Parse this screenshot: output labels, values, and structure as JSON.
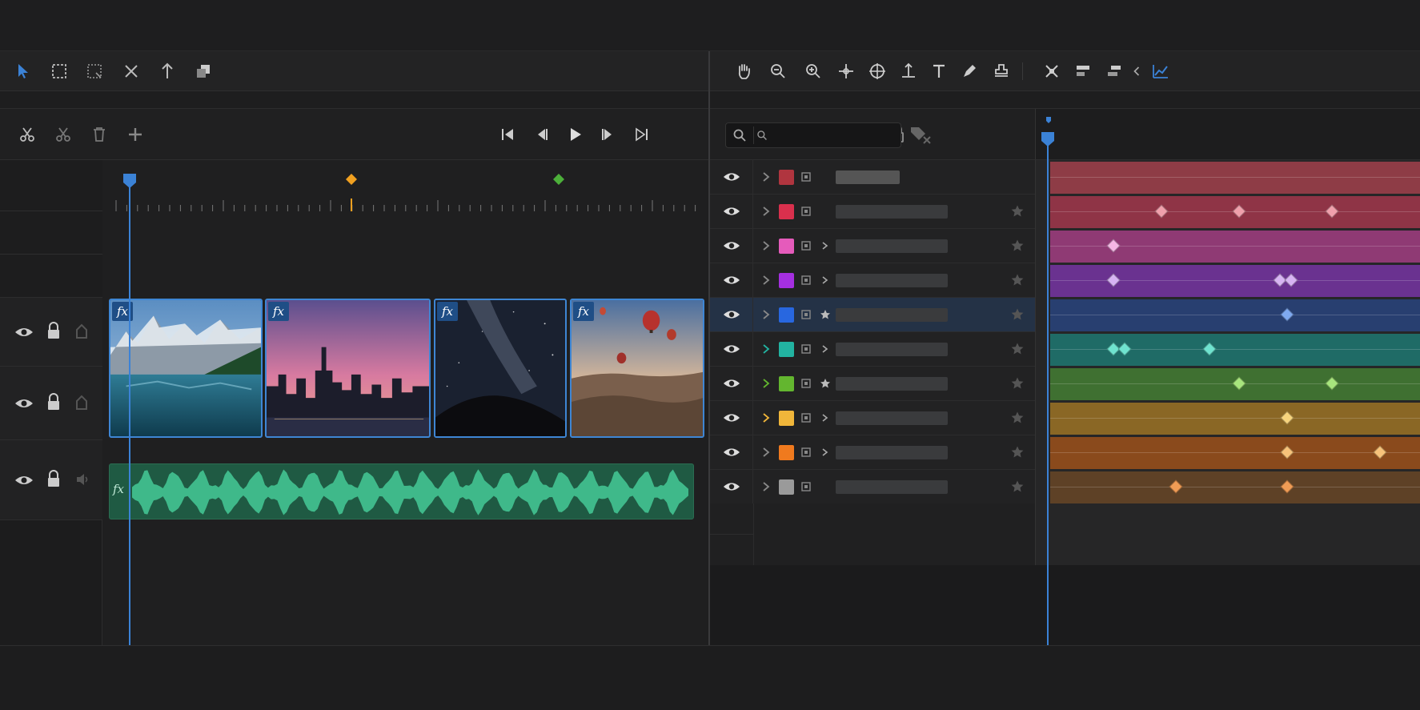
{
  "colors": {
    "accent": "#3b82d6",
    "marker_orange": "#f0a020",
    "marker_green": "#4caf3a",
    "audio_wave": "#3fb98a"
  },
  "left_toolbar": {
    "tools": [
      "select-arrow-icon",
      "marquee-select-icon",
      "lasso-select-icon",
      "ripple-edit-icon",
      "slip-tool-icon",
      "stack-icon"
    ]
  },
  "edit_tools": [
    "razor-icon",
    "cut-icon",
    "trash-icon",
    "insert-icon"
  ],
  "transport": [
    "skip-to-start-icon",
    "step-back-icon",
    "play-icon",
    "step-forward-icon",
    "skip-to-end-icon"
  ],
  "video_clips": [
    {
      "fx": "fx",
      "scene": "mountain-lake"
    },
    {
      "fx": "fx",
      "scene": "city-sunset"
    },
    {
      "fx": "fx",
      "scene": "milky-way"
    },
    {
      "fx": "fx",
      "scene": "hot-air-balloons"
    }
  ],
  "audio_clip": {
    "fx": "fx"
  },
  "right_toolbar": {
    "tools": [
      "hand-icon",
      "zoom-out-icon",
      "zoom-in-icon",
      "move-anchor-icon",
      "orbit-icon",
      "pan-behind-icon",
      "type-tool-icon",
      "pen-tool-icon",
      "stamp-icon",
      "distribute-icon",
      "align-icon",
      "align-alt-icon",
      "collapse-left-icon",
      "graph-editor-icon"
    ]
  },
  "search": {
    "placeholder": ""
  },
  "layers": [
    {
      "color": "#b0353f",
      "track": "#8e3c46",
      "kf_color": "#f0a0a8",
      "keyframes": [],
      "starred": false,
      "selected": false
    },
    {
      "color": "#d9304d",
      "track": "#8f3446",
      "kf_color": "#f0a0ac",
      "keyframes": [
        0.3,
        0.51,
        0.76
      ],
      "starred": true,
      "selected": false
    },
    {
      "color": "#e55bbb",
      "track": "#8f3a74",
      "kf_color": "#f5b7e4",
      "keyframes": [
        0.17
      ],
      "starred": true,
      "selected": false
    },
    {
      "color": "#a52fe0",
      "track": "#6a3290",
      "kf_color": "#d7b4f3",
      "keyframes": [
        0.17,
        0.62,
        0.65
      ],
      "starred": true,
      "selected": false
    },
    {
      "color": "#2867e0",
      "track": "#283f70",
      "kf_color": "#7fa9ef",
      "keyframes": [
        0.64
      ],
      "starred": true,
      "selected": true
    },
    {
      "color": "#22b3a1",
      "track": "#1f6b66",
      "kf_color": "#6fe3cf",
      "keyframes": [
        0.17,
        0.2,
        0.43
      ],
      "starred": true,
      "selected": false
    },
    {
      "color": "#63b62f",
      "track": "#3f7031",
      "kf_color": "#a7e57d",
      "keyframes": [
        0.51,
        0.76
      ],
      "starred": true,
      "selected": false
    },
    {
      "color": "#f0b63a",
      "track": "#8a6725",
      "kf_color": "#f7d47d",
      "keyframes": [
        0.64
      ],
      "starred": true,
      "selected": false
    },
    {
      "color": "#f07a1e",
      "track": "#8a4a1c",
      "kf_color": "#f7c27a",
      "keyframes": [
        0.64,
        0.89
      ],
      "starred": true,
      "selected": false
    },
    {
      "color": "#9a9a9a",
      "track": "#5e4126",
      "kf_color": "#f09c55",
      "keyframes": [
        0.34,
        0.64
      ],
      "starred": true,
      "selected": false
    }
  ]
}
